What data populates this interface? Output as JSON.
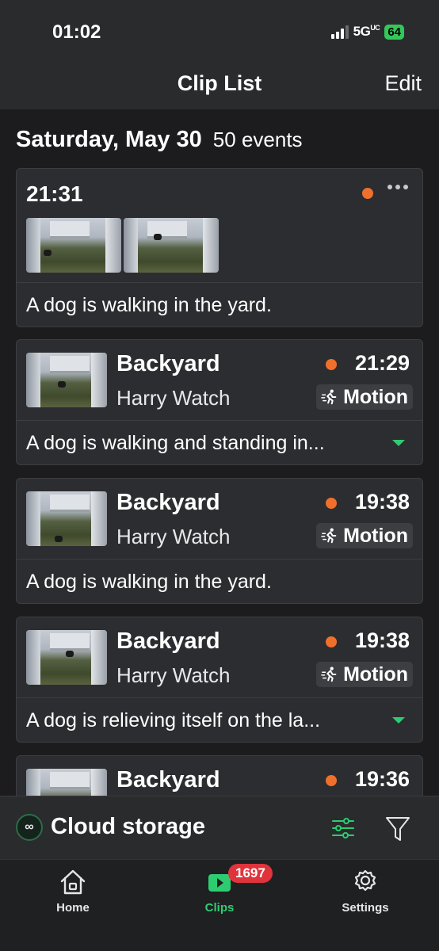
{
  "status_bar": {
    "time": "01:02",
    "network": "5G",
    "network_suffix": "UC",
    "battery": "64"
  },
  "nav": {
    "title": "Clip List",
    "edit_label": "Edit"
  },
  "date_header": {
    "date": "Saturday, May 30",
    "events": "50 events"
  },
  "first_event": {
    "time": "21:31",
    "description": "A dog is walking in the yard."
  },
  "events": [
    {
      "title": "Backyard",
      "device": "Harry Watch",
      "time": "21:29",
      "badge": "Motion",
      "description": "A dog is walking and standing in..."
    },
    {
      "title": "Backyard",
      "device": "Harry Watch",
      "time": "19:38",
      "badge": "Motion",
      "description": "A dog is walking in the yard."
    },
    {
      "title": "Backyard",
      "device": "Harry Watch",
      "time": "19:38",
      "badge": "Motion",
      "description": "A dog is relieving itself on the la..."
    },
    {
      "title": "Backyard",
      "time": "19:36"
    }
  ],
  "cloud_bar": {
    "icon_text": "∞",
    "label": "Cloud storage"
  },
  "tab_bar": {
    "home_label": "Home",
    "clips_label": "Clips",
    "clips_badge": "1697",
    "settings_label": "Settings"
  },
  "colors": {
    "accent_green": "#2ecc71",
    "event_dot": "#f0702b",
    "badge_red": "#e0343c"
  },
  "icons": [
    "cellular-signal-icon",
    "battery-icon",
    "more-icon",
    "motion-icon",
    "expand-caret-icon",
    "cloud-storage-icon",
    "adjust-icon",
    "filter-icon",
    "home-icon",
    "clips-icon",
    "settings-icon"
  ]
}
